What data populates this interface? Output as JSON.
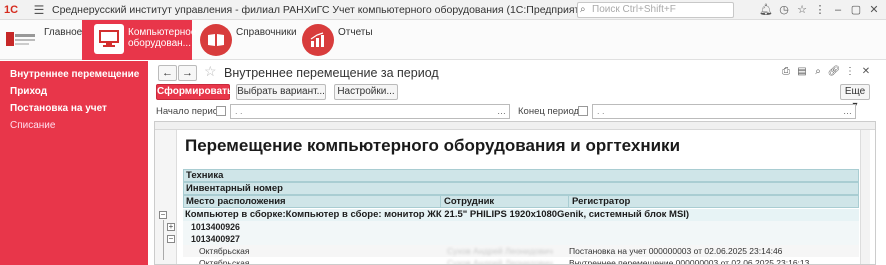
{
  "titlebar": {
    "logo": "1С",
    "title": "Среднерусский институт управления - филиал РАНХиГС Учет компьютерного оборудования  (1С:Предприятие, учебная версия)",
    "search_placeholder": "Поиск Ctrl+Shift+F",
    "icons": [
      "bell-icon",
      "history-icon",
      "star-icon",
      "menu-icon",
      "minimize-icon",
      "restore-icon",
      "close-icon"
    ]
  },
  "sections": {
    "main": "Главное",
    "computers": "Компьютерное оборудован...",
    "references": "Справочники",
    "reports": "Отчеты"
  },
  "leftnav": {
    "items": [
      {
        "label": "Внутреннее  перемещение",
        "bold": true
      },
      {
        "label": "Приход",
        "bold": true
      },
      {
        "label": "Постановка на учет",
        "bold": true
      },
      {
        "label": "Списание",
        "bold": false
      }
    ]
  },
  "form": {
    "back": "←",
    "forward": "→",
    "title": "Внутреннее перемещение за период",
    "buttons": {
      "generate": "Сформировать",
      "choose_variant": "Выбрать вариант...",
      "settings": "Настройки...",
      "more": "Еще"
    },
    "period_start_label": "Начало период:",
    "period_end_label": "Конец периода:",
    "date_placeholder": ". ."
  },
  "report": {
    "title": "Перемещение компьютерного оборудования и оргтехники",
    "header_rows": [
      "Техника",
      "Инвентарный номер"
    ],
    "columns": [
      "Место расположения",
      "Сотрудник",
      "Регистратор"
    ],
    "group": "Компьютер в сборке:Компьютер в сборе: монитор ЖК 21.5\" PHILIPS  1920x1080Genik, системный блок MSI)",
    "inventory": [
      "1013400926",
      "1013400927"
    ],
    "rows": [
      {
        "location": "Октябрьская",
        "employee": "Сухов Андрей Леонидович",
        "registrar": "Постановка на учет 000000003 от 02.06.2025 23:14:46"
      },
      {
        "location": "Октябрьская",
        "employee": "Сухов Андрей Леонидович",
        "registrar": "Внутреннее  перемещение 000000003 от 02.06.2025 23:16:13"
      }
    ]
  }
}
